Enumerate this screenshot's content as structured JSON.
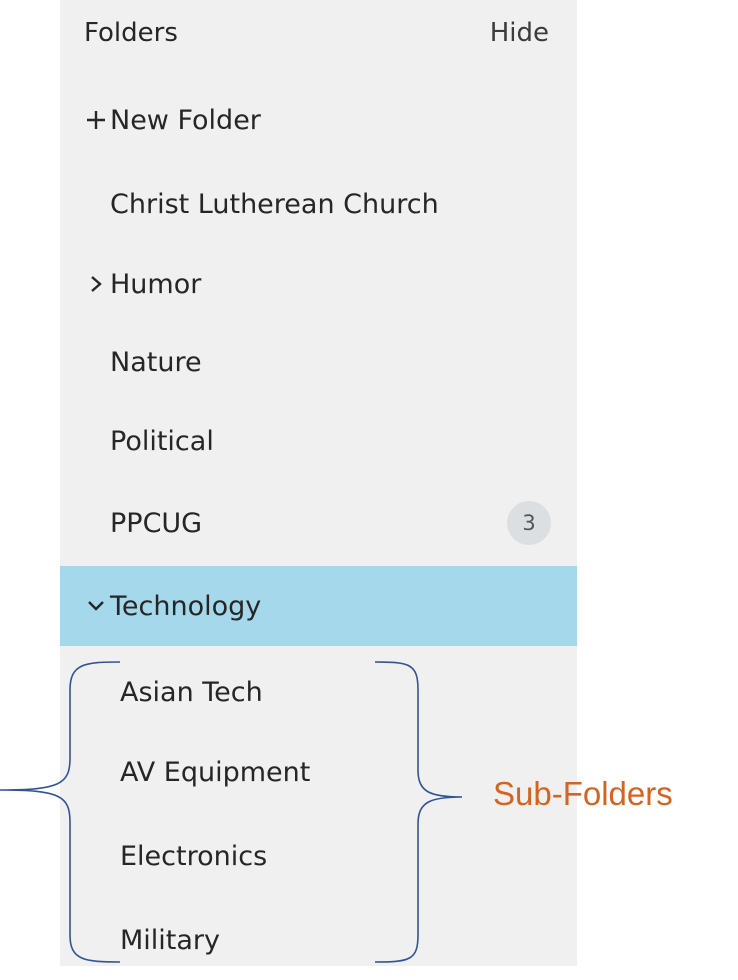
{
  "header": {
    "title": "Folders",
    "hide_label": "Hide"
  },
  "actions": {
    "new_folder_glyph": "+",
    "new_folder_label": "New Folder"
  },
  "folders": [
    {
      "label": "Christ Lutherean Church",
      "glyph": ""
    },
    {
      "label": "Humor",
      "glyph": "chevron-right-icon"
    },
    {
      "label": "Nature",
      "glyph": ""
    },
    {
      "label": "Political",
      "glyph": ""
    },
    {
      "label": "PPCUG",
      "glyph": "",
      "badge": "3"
    },
    {
      "label": "Technology",
      "glyph": "chevron-down-icon",
      "selected": true
    }
  ],
  "subfolders": [
    {
      "label": "Asian Tech"
    },
    {
      "label": "AV Equipment"
    },
    {
      "label": "Electronics"
    },
    {
      "label": "Military"
    }
  ],
  "annotation": {
    "label": "Sub-Folders",
    "color": "#d4641f",
    "bracket_color": "#1f4e79"
  },
  "colors": {
    "panel_bg": "#f0f0f0",
    "selected_bg": "#a6d8eb",
    "badge_bg": "#dcdfe2"
  }
}
